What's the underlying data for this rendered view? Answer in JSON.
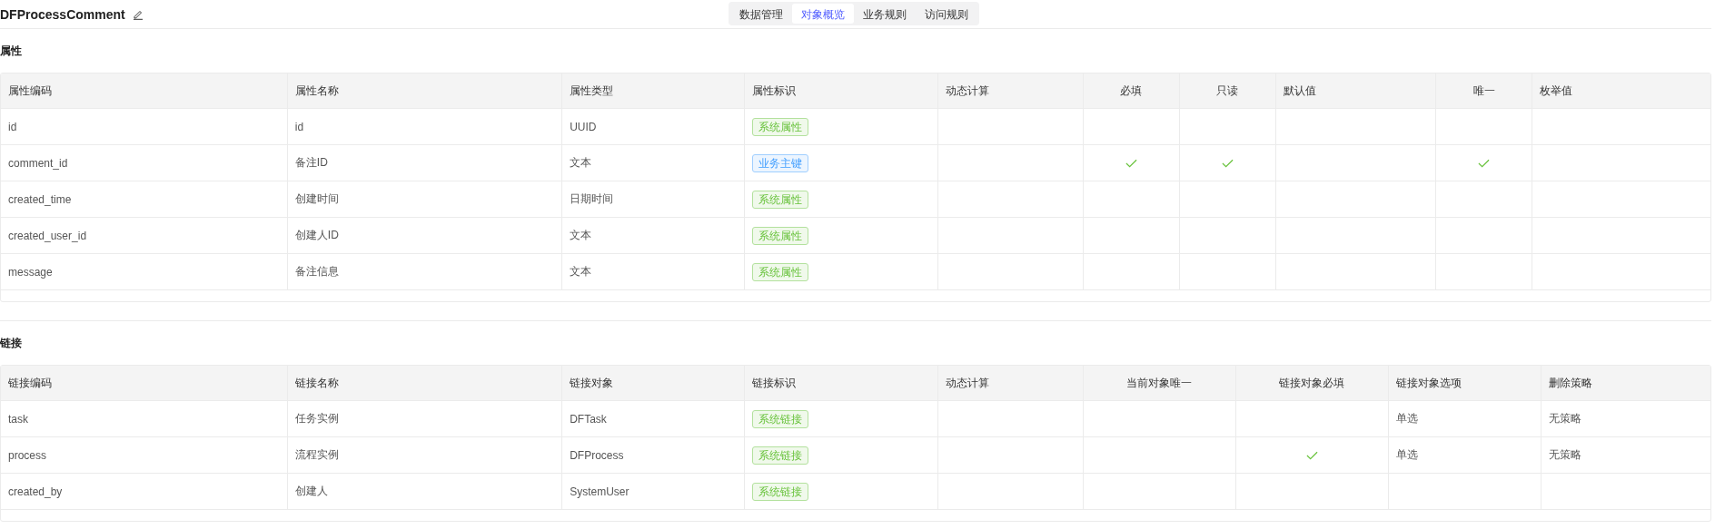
{
  "title": "DFProcessComment",
  "tabs": [
    {
      "label": "数据管理",
      "selected": false
    },
    {
      "label": "对象概览",
      "selected": true
    },
    {
      "label": "业务规则",
      "selected": false
    },
    {
      "label": "访问规则",
      "selected": false
    }
  ],
  "attributes": {
    "heading": "属性",
    "columns": [
      "属性编码",
      "属性名称",
      "属性类型",
      "属性标识",
      "动态计算",
      "必填",
      "只读",
      "默认值",
      "唯一",
      "枚举值"
    ],
    "rows": [
      {
        "code": "id",
        "name": "id",
        "type": "UUID",
        "tag": {
          "label": "系统属性",
          "kind": "system"
        },
        "required": false,
        "readonly": false,
        "unique": false
      },
      {
        "code": "comment_id",
        "name": "备注ID",
        "type": "文本",
        "tag": {
          "label": "业务主键",
          "kind": "key"
        },
        "required": true,
        "readonly": true,
        "unique": true
      },
      {
        "code": "created_time",
        "name": "创建时间",
        "type": "日期时间",
        "tag": {
          "label": "系统属性",
          "kind": "system"
        },
        "required": false,
        "readonly": false,
        "unique": false
      },
      {
        "code": "created_user_id",
        "name": "创建人ID",
        "type": "文本",
        "tag": {
          "label": "系统属性",
          "kind": "system"
        },
        "required": false,
        "readonly": false,
        "unique": false
      },
      {
        "code": "message",
        "name": "备注信息",
        "type": "文本",
        "tag": {
          "label": "系统属性",
          "kind": "system"
        },
        "required": false,
        "readonly": false,
        "unique": false
      }
    ]
  },
  "links": {
    "heading": "链接",
    "columns": [
      "链接编码",
      "链接名称",
      "链接对象",
      "链接标识",
      "动态计算",
      "当前对象唯一",
      "链接对象必填",
      "链接对象选项",
      "删除策略"
    ],
    "rows": [
      {
        "code": "task",
        "name": "任务实例",
        "target": "DFTask",
        "tag": {
          "label": "系统链接",
          "kind": "system"
        },
        "current_unique": false,
        "target_required": false,
        "option": "单选",
        "delete_policy": "无策略"
      },
      {
        "code": "process",
        "name": "流程实例",
        "target": "DFProcess",
        "tag": {
          "label": "系统链接",
          "kind": "system"
        },
        "current_unique": false,
        "target_required": true,
        "option": "单选",
        "delete_policy": "无策略"
      },
      {
        "code": "created_by",
        "name": "创建人",
        "target": "SystemUser",
        "tag": {
          "label": "系统链接",
          "kind": "system"
        },
        "current_unique": false,
        "target_required": false
      }
    ]
  }
}
